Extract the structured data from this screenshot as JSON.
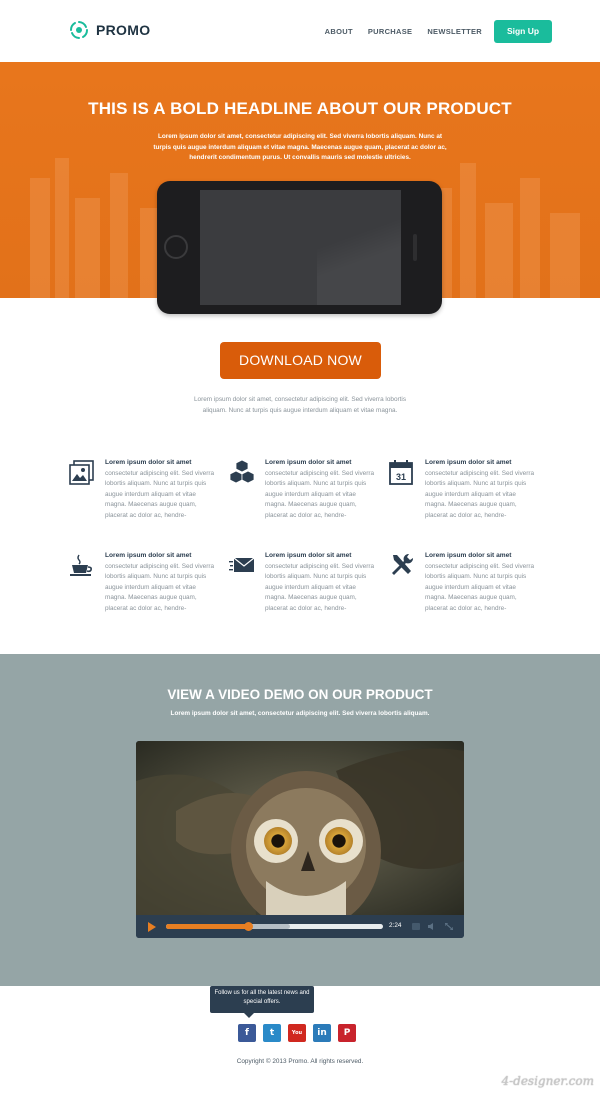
{
  "header": {
    "logo_text": "PROMO",
    "nav": [
      "ABOUT",
      "PURCHASE",
      "NEWSLETTER"
    ],
    "signup_label": "Sign Up"
  },
  "hero": {
    "title": "THIS IS A BOLD HEADLINE ABOUT OUR PRODUCT",
    "text": "Lorem ipsum dolor sit amet, consectetur adipiscing elit. Sed viverra lobortis aliquam. Nunc at turpis quis augue interdum aliquam et vitae magna. Maecenas augue quam, placerat ac dolor ac, hendrerit condimentum purus. Ut convallis mauris sed molestie ultricies."
  },
  "download": {
    "label": "DOWNLOAD NOW",
    "text": "Lorem ipsum dolor sit amet, consectetur adipiscing elit. Sed viverra lobortis aliquam. Nunc at turpis quis augue interdum aliquam et vitae magna."
  },
  "features": [
    {
      "icon": "images-icon",
      "title": "Lorem ipsum dolor sit amet",
      "text": "consectetur adipiscing elit. Sed viverra lobortis aliquam. Nunc at turpis quis augue interdum aliquam et vitae magna. Maecenas augue quam, placerat ac dolor ac, hendre-"
    },
    {
      "icon": "cubes-icon",
      "title": "Lorem ipsum dolor sit amet",
      "text": "consectetur adipiscing elit. Sed viverra lobortis aliquam. Nunc at turpis quis augue interdum aliquam et vitae magna. Maecenas augue quam, placerat ac dolor ac, hendre-"
    },
    {
      "icon": "calendar-icon",
      "icon_text": "31",
      "title": "Lorem ipsum dolor sit amet",
      "text": "consectetur adipiscing elit. Sed viverra lobortis aliquam. Nunc at turpis quis augue interdum aliquam et vitae magna. Maecenas augue quam, placerat ac dolor ac, hendre-"
    },
    {
      "icon": "coffee-cup-icon",
      "title": "Lorem ipsum dolor sit amet",
      "text": "consectetur adipiscing elit. Sed viverra lobortis aliquam. Nunc at turpis quis augue interdum aliquam et vitae magna. Maecenas augue quam, placerat ac dolor ac, hendre-"
    },
    {
      "icon": "mail-icon",
      "title": "Lorem ipsum dolor sit amet",
      "text": "consectetur adipiscing elit. Sed viverra lobortis aliquam. Nunc at turpis quis augue interdum aliquam et vitae magna. Maecenas augue quam, placerat ac dolor ac, hendre-"
    },
    {
      "icon": "tools-icon",
      "title": "Lorem ipsum dolor sit amet",
      "text": "consectetur adipiscing elit. Sed viverra lobortis aliquam. Nunc at turpis quis augue interdum aliquam et vitae magna. Maecenas augue quam, placerat ac dolor ac, hendre-"
    }
  ],
  "video": {
    "title": "VIEW A VIDEO DEMO ON OUR PRODUCT",
    "subtitle": "Lorem ipsum dolor sit amet, consectetur adipiscing elit. Sed viverra lobortis aliquam.",
    "time": "2:24",
    "progress_fraction": 0.38,
    "buffered_fraction": 0.57
  },
  "footer": {
    "tooltip": "Follow us for all the latest news and special offers.",
    "social": [
      {
        "name": "facebook-icon",
        "glyph": "f",
        "color": "#3b5998"
      },
      {
        "name": "twitter-icon",
        "glyph": "t",
        "color": "#2a8ac8"
      },
      {
        "name": "youtube-icon",
        "glyph": "You",
        "color": "#d0281f"
      },
      {
        "name": "linkedin-icon",
        "glyph": "in",
        "color": "#2b7bb9"
      },
      {
        "name": "pinterest-icon",
        "glyph": "P",
        "color": "#c8232c"
      }
    ],
    "copyright": "Copyright © 2013 Promo. All rights reserved."
  },
  "watermark": "4-designer.com",
  "colors": {
    "accent_orange": "#e8761c",
    "download_orange": "#d95c0a",
    "teal": "#1abc9c",
    "navy": "#2c3e50",
    "video_bg": "#95a5a6"
  }
}
